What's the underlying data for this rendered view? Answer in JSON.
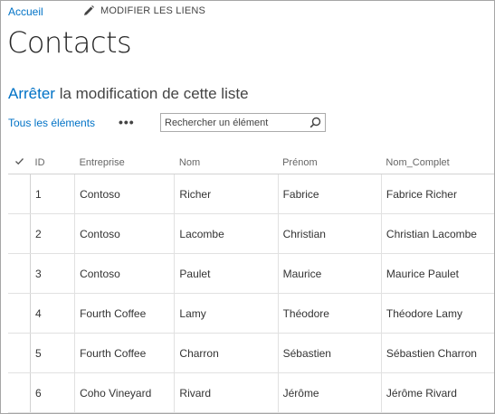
{
  "breadcrumb": {
    "home_label": "Accueil",
    "edit_links_label": "MODIFIER LES LIENS"
  },
  "page": {
    "title": "Contacts"
  },
  "edit_mode": {
    "stop_label": "Arrêter",
    "rest_label": " la modification de cette liste"
  },
  "views": {
    "all_items_label": "Tous les éléments",
    "more_label": "•••"
  },
  "search": {
    "placeholder": "Rechercher un élément",
    "value": ""
  },
  "table": {
    "columns": [
      "ID",
      "Entreprise",
      "Nom",
      "Prénom",
      "Nom_Complet"
    ],
    "rows": [
      [
        "1",
        "Contoso",
        "Richer",
        "Fabrice",
        "Fabrice Richer"
      ],
      [
        "2",
        "Contoso",
        "Lacombe",
        "Christian",
        "Christian Lacombe"
      ],
      [
        "3",
        "Contoso",
        "Paulet",
        "Maurice",
        "Maurice Paulet"
      ],
      [
        "4",
        "Fourth Coffee",
        "Lamy",
        "Théodore",
        "Théodore Lamy"
      ],
      [
        "5",
        "Fourth Coffee",
        "Charron",
        "Sébastien",
        "Sébastien Charron"
      ],
      [
        "6",
        "Coho Vineyard",
        "Rivard",
        "Jérôme",
        "Jérôme Rivard"
      ]
    ]
  },
  "colors": {
    "link": "#0072c6",
    "text": "#333333",
    "border": "#e1e1e1"
  }
}
